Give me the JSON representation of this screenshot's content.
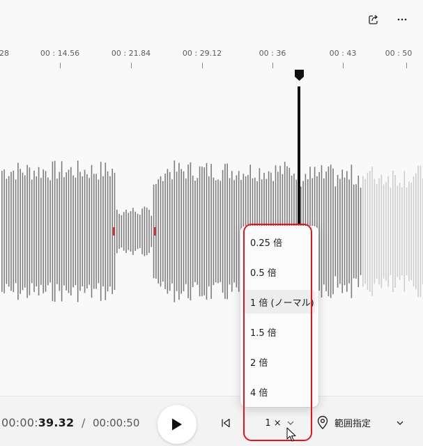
{
  "colors": {
    "waveform_played": "#7c7c7c",
    "waveform_unplayed": "#cdcdcd",
    "marker": "#d13438",
    "playhead": "#111111",
    "highlight": "#e8131a"
  },
  "toolbar": {
    "share_icon": "share-icon",
    "more_icon": "more-icon"
  },
  "timeline": {
    "ticks": [
      "28",
      "00 : 14.56",
      "00 : 21.84",
      "00 : 29.12",
      "00 : 36",
      "00 : 43",
      "00 : 50"
    ],
    "playhead_progress": 0.852
  },
  "playback": {
    "current_dim": "00:00:",
    "current_bold": "39.32",
    "separator": "/",
    "total": "00:00:50",
    "speed_label": "1 ×",
    "marker_label": "範囲指定"
  },
  "speed_menu": {
    "items": [
      "0.25 倍",
      "0.5 倍",
      "1 倍 (ノーマル)",
      "1.5 倍",
      "2 倍",
      "4 倍"
    ],
    "selected_index": 2
  }
}
